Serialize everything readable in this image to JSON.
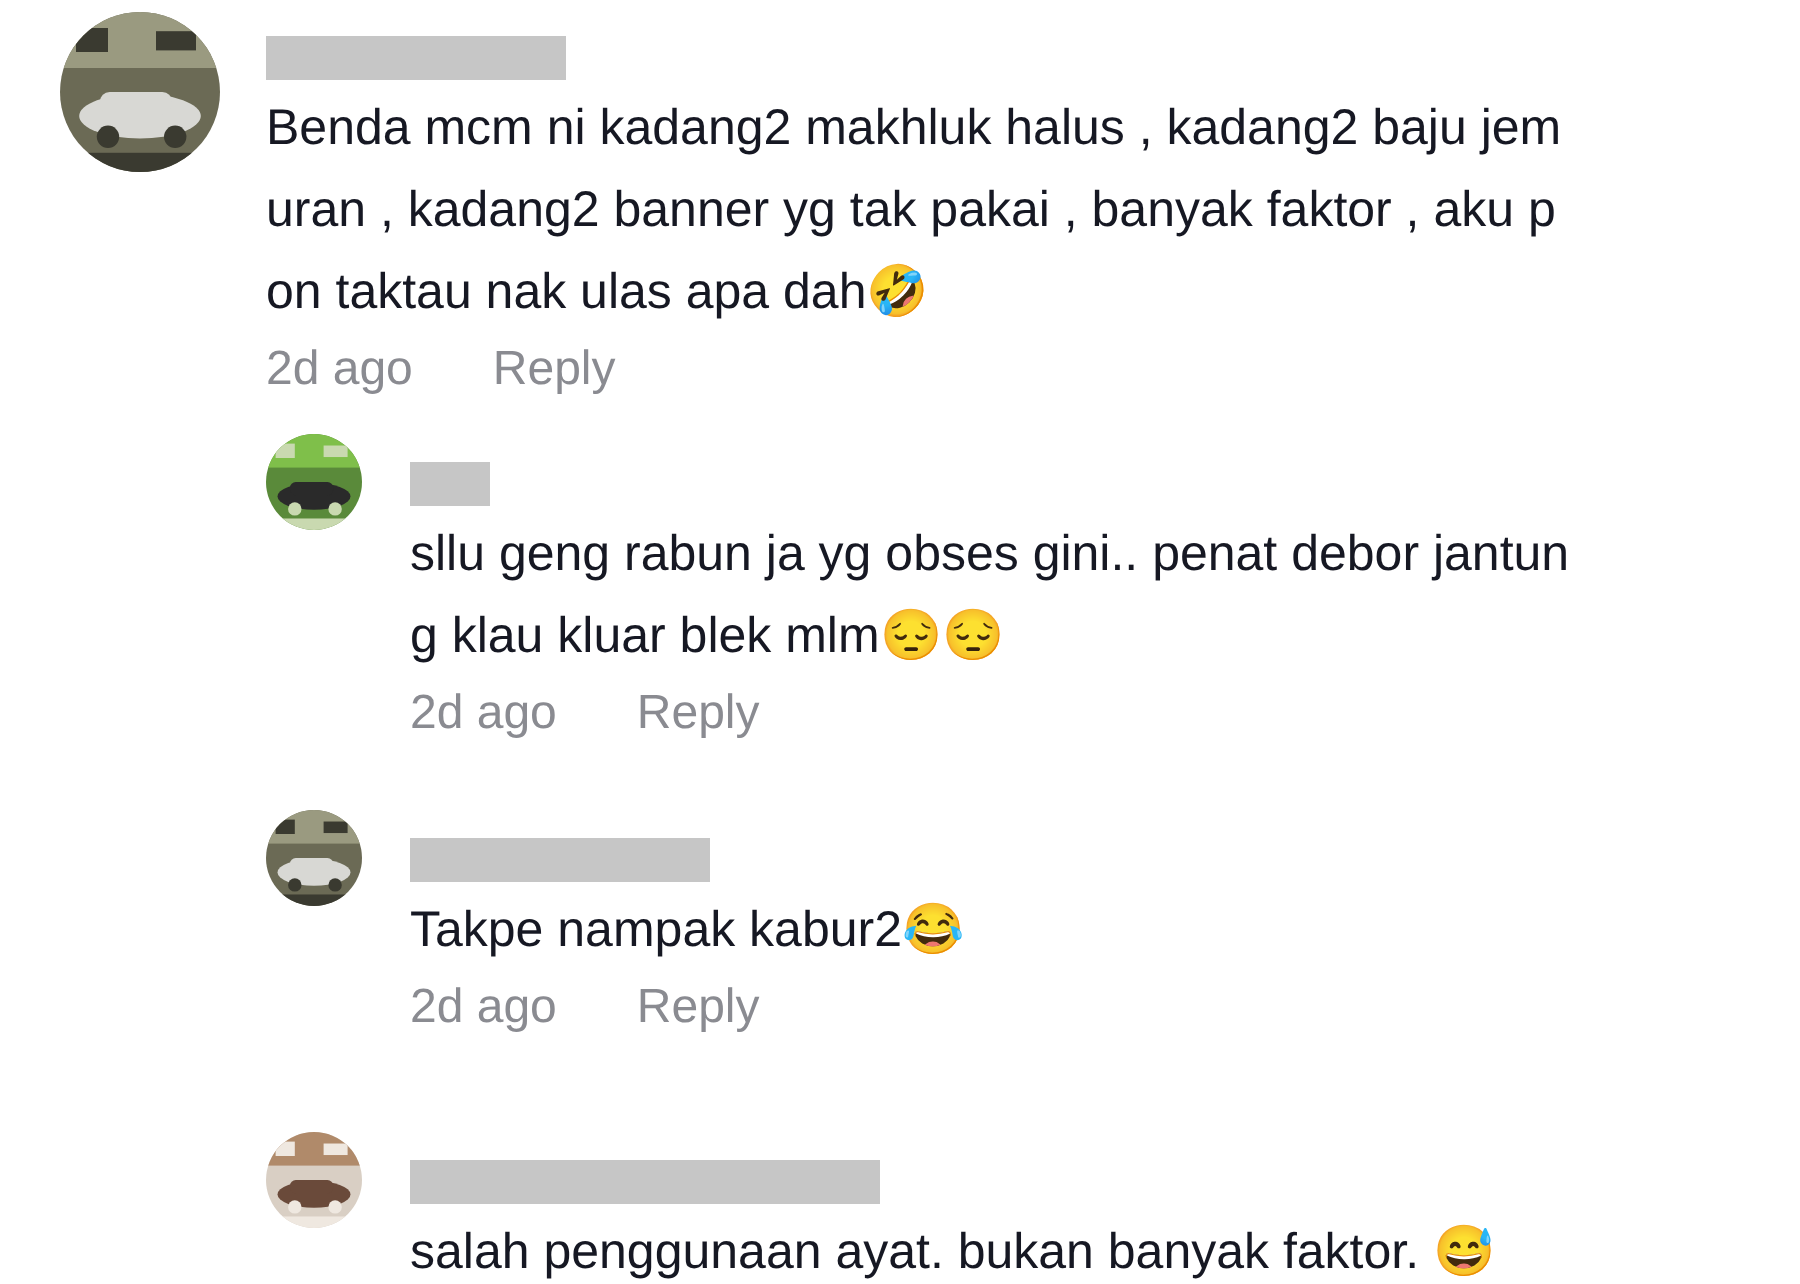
{
  "comments": [
    {
      "lines": [
        "Benda mcm ni kadang2 makhluk halus , kadang2 baju jem",
        "uran , kadang2 banner yg tak pakai , banyak faktor , aku p",
        "on taktau nak ulas apa dah🤣"
      ],
      "time": "2d ago",
      "reply": "Reply",
      "replies": [
        {
          "lines": [
            "sllu geng rabun ja yg obses gini.. penat debor jantun",
            "g klau kluar blek mlm😔😔"
          ],
          "time": "2d ago",
          "reply": "Reply"
        },
        {
          "lines": [
            "Takpe nampak kabur2😂"
          ],
          "time": "2d ago",
          "reply": "Reply"
        },
        {
          "lines": [
            "salah penggunaan ayat. bukan banyak faktor. 😅"
          ]
        }
      ]
    }
  ]
}
